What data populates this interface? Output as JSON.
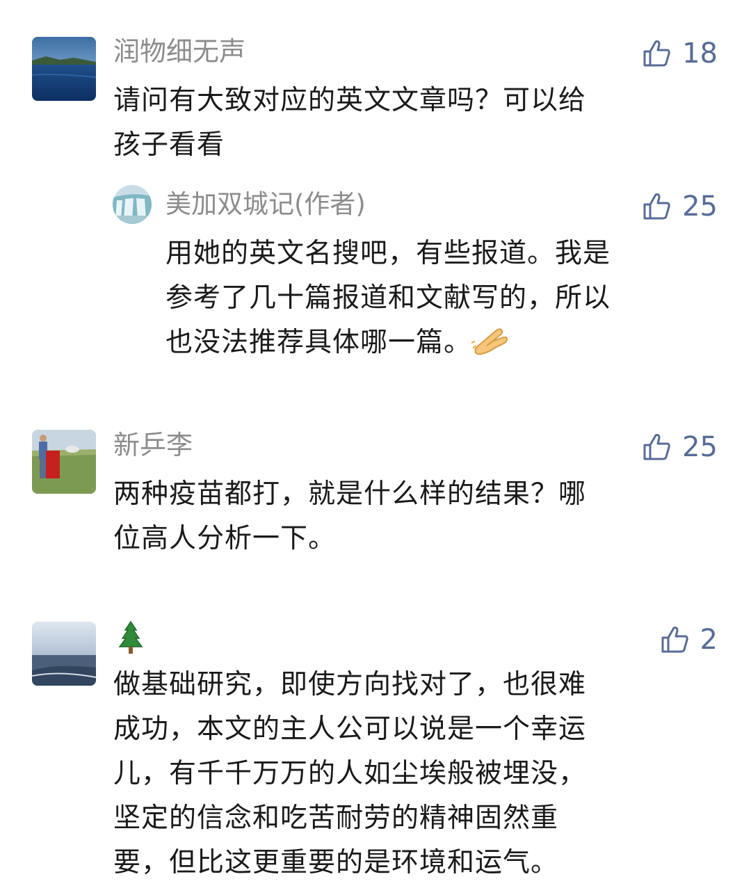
{
  "comments": [
    {
      "name": "润物细无声",
      "likes": "18",
      "lines": [
        "请问有大致对应的英文文章吗？可以给",
        "孩子看看"
      ],
      "reply": {
        "name": "美加双城记(作者)",
        "likes": "25",
        "lines": [
          "用她的英文名搜吧，有些报道。我是",
          "参考了几十篇报道和文献写的，所以",
          "也没法推荐具体哪一篇。"
        ]
      }
    },
    {
      "name": "新乒李",
      "likes": "25",
      "lines": [
        "两种疫苗都打，就是什么样的结果？哪",
        "位高人分析一下。"
      ]
    },
    {
      "name": "",
      "likes": "2",
      "lines": [
        "做基础研究，即使方向找对了，也很难",
        "成功，本文的主人公可以说是一个幸运",
        "儿，有千千万万的人如尘埃般被埋没，",
        "坚定的信念和吃苦耐劳的精神固然重",
        "要，但比这更重要的是环境和运气。"
      ]
    }
  ],
  "icons": {
    "like": "thumbs-up-icon",
    "hands": "pressed-hands-emoji",
    "tree": "evergreen-tree-emoji"
  },
  "colors": {
    "name": "#8c8c8c",
    "text": "#1a1a1a",
    "like": "#576b95"
  }
}
